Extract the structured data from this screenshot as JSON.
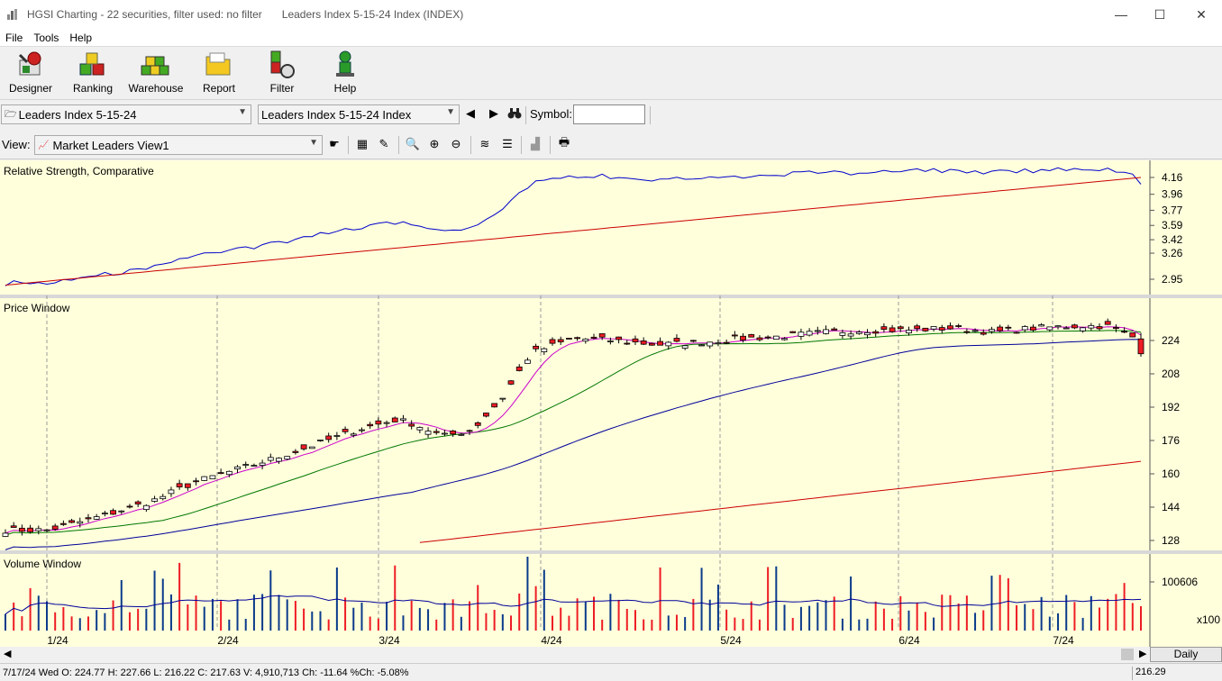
{
  "window": {
    "app_title": "HGSI Charting - 22 securities, filter used: no filter",
    "doc_title": "Leaders Index 5-15-24 Index (INDEX)",
    "minimize": "—",
    "maximize": "☐",
    "close": "✕"
  },
  "menu": [
    "File",
    "Tools",
    "Help"
  ],
  "toolbar": [
    {
      "label": "Designer",
      "icon": "designer-icon"
    },
    {
      "label": "Ranking",
      "icon": "ranking-icon"
    },
    {
      "label": "Warehouse",
      "icon": "warehouse-icon"
    },
    {
      "label": "Report",
      "icon": "report-icon"
    },
    {
      "label": "Filter",
      "icon": "filter-icon"
    },
    {
      "label": "Help",
      "icon": "help-icon"
    }
  ],
  "selectors": {
    "list_value": "Leaders Index 5-15-24",
    "security_value": "Leaders Index 5-15-24 Index",
    "symbol_label": "Symbol:",
    "symbol_value": "",
    "view_label": "View:",
    "view_value": "Market Leaders View1"
  },
  "status": {
    "text": "7/17/24 Wed O: 224.77 H: 227.66 L: 216.22 C: 217.63 V: 4,910,713 Ch: -11.64 %Ch: -5.08%",
    "last": "216.29",
    "period": "Daily"
  },
  "colors": {
    "panel_bg": "#ffffdc",
    "up": "#ffffff",
    "down": "#ee1c24",
    "rs_line": "#0000cc",
    "rs_ma": "#cc0000",
    "ma10": "#cc00cc",
    "ma20": "#007700",
    "ma50": "#000099",
    "ma200": "#cc0000",
    "vol_up": "#0a3a8a",
    "vol_down": "#ee1c24"
  },
  "chart_data": {
    "type": "candlestick",
    "date_labels": [
      "1/24",
      "2/24",
      "3/24",
      "4/24",
      "5/24",
      "6/24",
      "7/24"
    ],
    "panels": [
      {
        "title": "Relative Strength, Comparative",
        "yticks": [
          "4.16",
          "3.96",
          "3.77",
          "3.59",
          "3.42",
          "3.26",
          "2.95"
        ]
      },
      {
        "title": "Price Window",
        "yticks": [
          "224",
          "208",
          "192",
          "176",
          "160",
          "144",
          "128"
        ]
      },
      {
        "title": "Volume Window",
        "yticks": [
          "100606"
        ],
        "unit": "x100"
      }
    ],
    "price_start": 133.5,
    "price_end": 217.6,
    "last_bar": {
      "date": "7/17/24",
      "open": 224.77,
      "high": 227.66,
      "low": 216.22,
      "close": 217.63,
      "volume": 4910713
    }
  }
}
